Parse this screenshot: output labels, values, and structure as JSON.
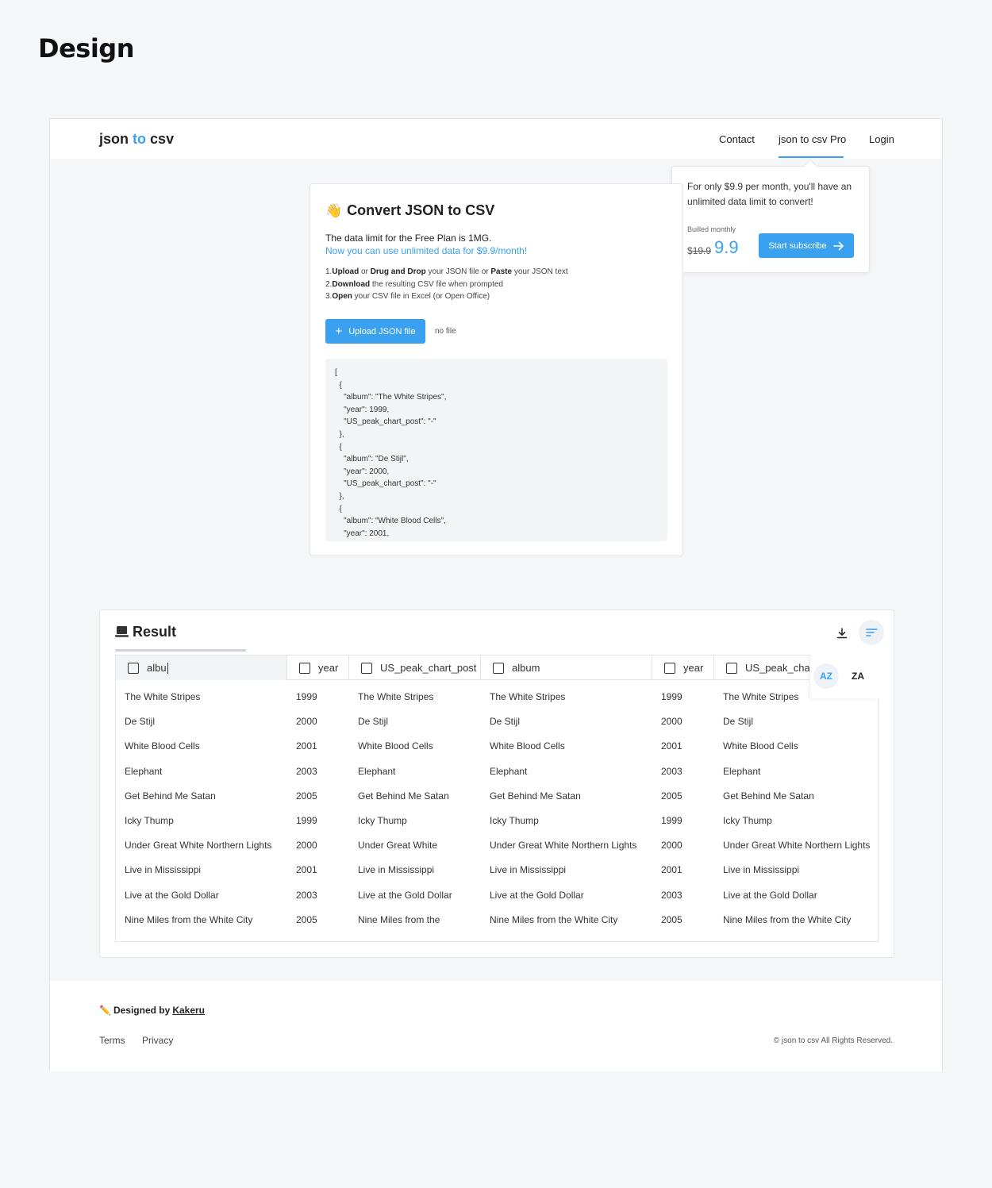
{
  "page_heading": "Design",
  "nav": {
    "logo_part1": "json",
    "logo_part2": "to",
    "logo_part3": "csv",
    "contact": "Contact",
    "pro": "json to csv Pro",
    "login": "Login",
    "accent_color": "#3aa0f0"
  },
  "pro_popover": {
    "text": "For only $9.9 per month, you'll have an unlimited data limit to convert!",
    "billed": "Builled monthly",
    "currency": "$",
    "old_price": "19.9",
    "new_price": "9.9",
    "button": "Start subscribe",
    "button_icon": "arrow-right-icon"
  },
  "convert": {
    "emoji": "👋",
    "title": "Convert JSON to CSV",
    "limit": "The data limit for the Free Plan is 1MG.",
    "unlimited": "Now you can use unlimited data for $9.9/month!",
    "steps": [
      {
        "num": "1.",
        "bold1": "Upload",
        "mid1": " or ",
        "bold2": "Drug and Drop",
        "mid2": " your JSON file  or ",
        "bold3": "Paste",
        "rest": " your JSON text"
      },
      {
        "num": "2.",
        "bold1": "Download",
        "rest": " the resulting CSV file when prompted"
      },
      {
        "num": "3.",
        "bold1": "Open",
        "rest": " your CSV file in Excel (or Open Office)"
      }
    ],
    "upload_button": "Upload JSON file",
    "no_file": "no file",
    "json_text": "[\n  {\n    \"album\": \"The White Stripes\",\n    \"year\": 1999,\n    \"US_peak_chart_post\": \"-\"\n  },\n  {\n    \"album\": \"De Stijl\",\n    \"year\": 2000,\n    \"US_peak_chart_post\": \"-\"\n  },\n  {\n    \"album\": \"White Blood Cells\",\n    \"year\": 2001,"
  },
  "result": {
    "emoji_icon": "laptop-icon",
    "title": "Result",
    "headers": [
      "albu",
      "year",
      "US_peak_chart_post",
      "album",
      "year",
      "US_peak_cha"
    ],
    "rows": [
      [
        "The White Stripes",
        "1999",
        "The White Stripes",
        "The White Stripes",
        "1999",
        "The White Stripes"
      ],
      [
        "De Stijl",
        "2000",
        "De Stijl",
        "De Stijl",
        "2000",
        "De Stijl"
      ],
      [
        "White Blood Cells",
        "2001",
        "White Blood Cells",
        "White Blood Cells",
        "2001",
        "White Blood Cells"
      ],
      [
        "Elephant",
        "2003",
        "Elephant",
        "Elephant",
        "2003",
        "Elephant"
      ],
      [
        "Get Behind Me Satan",
        "2005",
        "Get Behind Me Satan",
        "Get Behind Me Satan",
        "2005",
        "Get Behind Me Satan"
      ],
      [
        "Icky Thump",
        "1999",
        "Icky Thump",
        "Icky Thump",
        "1999",
        "Icky Thump"
      ],
      [
        "Under Great White Northern Lights",
        "2000",
        "Under Great White",
        "Under Great White Northern Lights",
        "2000",
        "Under Great White Northern Lights"
      ],
      [
        "Live in Mississippi",
        "2001",
        "Live in Mississippi",
        "Live in Mississippi",
        "2001",
        "Live in Mississippi"
      ],
      [
        "Live at the Gold Dollar",
        "2003",
        "Live at the Gold Dollar",
        "Live at the Gold Dollar",
        "2003",
        "Live at the Gold Dollar"
      ],
      [
        "Nine Miles from the White City",
        "2005",
        "Nine Miles from the",
        "Nine Miles from the White City",
        "2005",
        "Nine Miles from the White City"
      ]
    ],
    "sort_az": "AZ",
    "sort_za": "ZA"
  },
  "footer": {
    "emoji": "✏️",
    "designed_by": "Designed by",
    "author": "Kakeru",
    "terms": "Terms",
    "privacy": "Privacy",
    "copyright": "© json to csv All Rights Reserved."
  }
}
